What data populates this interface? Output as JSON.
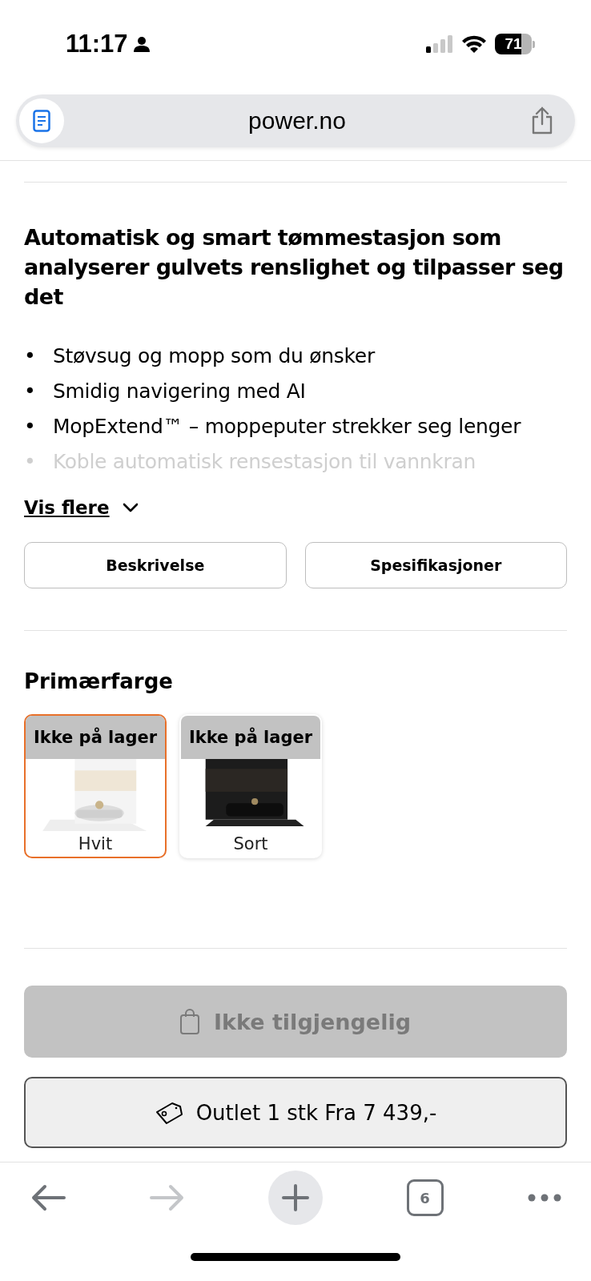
{
  "status_bar": {
    "time": "11:17",
    "battery": "71"
  },
  "address_bar": {
    "url": "power.no"
  },
  "product": {
    "heading": "Automatisk og smart tømmestasjon som analyserer gulvets renslighet og tilpasser seg det",
    "features": [
      {
        "bullet": "•",
        "text": "Støvsug og mopp som du ønsker",
        "faded": false
      },
      {
        "bullet": "•",
        "text": "Smidig navigering med AI",
        "faded": false
      },
      {
        "bullet": "•",
        "text": "MopExtend™ – moppeputer strekker seg lenger",
        "faded": false
      },
      {
        "bullet": "•",
        "text": "Koble automatisk rensestasjon til vannkran",
        "faded": true
      }
    ],
    "show_more": "Vis flere",
    "tabs": [
      {
        "label": "Beskrivelse"
      },
      {
        "label": "Spesifikasjoner"
      }
    ]
  },
  "color_picker": {
    "title": "Primærfarge",
    "options": [
      {
        "badge": "Ikke på lager",
        "name": "Hvit",
        "kind": "white",
        "selected": true
      },
      {
        "badge": "Ikke på lager",
        "name": "Sort",
        "kind": "black",
        "selected": false
      }
    ]
  },
  "actions": {
    "unavailable": {
      "label": "Ikke tilgjengelig",
      "disabled": true
    },
    "outlet": {
      "label": "Outlet 1 stk Fra 7 439,-"
    }
  },
  "toolbar": {
    "forward_disabled": true,
    "tab_count": "6"
  }
}
